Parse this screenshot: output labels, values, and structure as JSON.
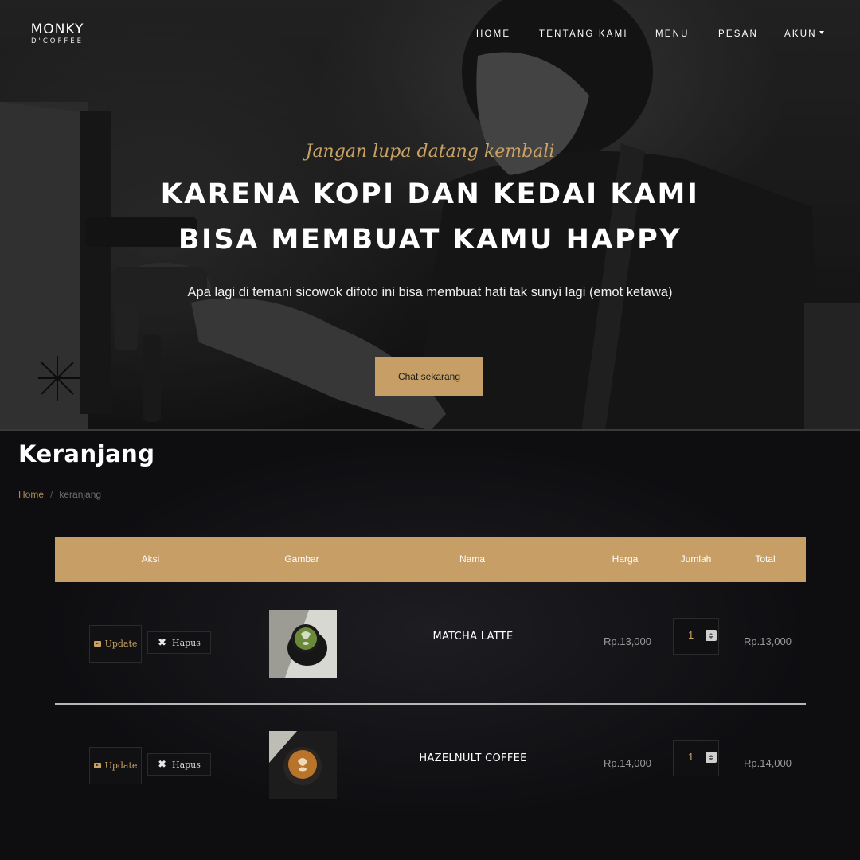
{
  "brand": {
    "name": "MONKY",
    "sub": "D'COFFEE"
  },
  "nav": {
    "items": [
      {
        "label": "HOME"
      },
      {
        "label": "TENTANG KAMI"
      },
      {
        "label": "MENU"
      },
      {
        "label": "PESAN"
      },
      {
        "label": "AKUN"
      }
    ]
  },
  "hero": {
    "tagline": "Jangan lupa datang kembali",
    "title_line1": "KARENA KOPI DAN KEDAI KAMI",
    "title_line2": "BISA MEMBUAT KAMU HAPPY",
    "description": "Apa lagi di temani sicowok difoto ini bisa membuat hati tak sunyi lagi (emot ketawa)",
    "cta_label": "Chat sekarang"
  },
  "page": {
    "title": "Keranjang"
  },
  "breadcrumb": {
    "home": "Home",
    "separator": "/",
    "current": "keranjang"
  },
  "cart": {
    "columns": {
      "aksi": "Aksi",
      "gambar": "Gambar",
      "nama": "Nama",
      "harga": "Harga",
      "jumlah": "Jumlah",
      "total": "Total"
    },
    "update_label": "Update",
    "delete_label": "Hapus",
    "rows": [
      {
        "name": "MATCHA LATTE",
        "price": "Rp.13,000",
        "qty": "1",
        "total": "Rp.13,000"
      },
      {
        "name": "HAZELNULT COFFEE",
        "price": "Rp.14,000",
        "qty": "1",
        "total": "Rp.14,000"
      }
    ]
  },
  "colors": {
    "accent": "#c79f66",
    "background": "#0e0e11",
    "hero_text": "#ffffff"
  }
}
